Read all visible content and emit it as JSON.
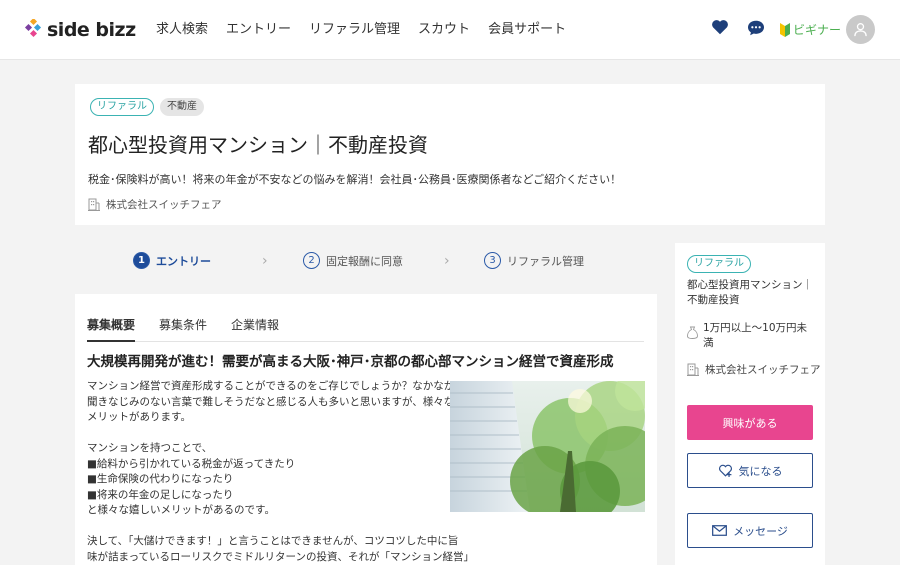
{
  "header": {
    "logo_text": "side bizz",
    "nav": [
      "求人検索",
      "エントリー",
      "リファラル管理",
      "スカウト",
      "会員サポート"
    ],
    "beginner_label": "ビギナー",
    "brand_color": "#1e4c9a"
  },
  "job": {
    "tags": [
      "リファラル",
      "不動産"
    ],
    "title": "都心型投資用マンション｜不動産投資",
    "description": "税金･保険料が高い！将来の年金が不安などの悩みを解消！会社員･公務員･医療関係者などご紹介ください！",
    "company": "株式会社スイッチフェア"
  },
  "steps": [
    {
      "num": "1",
      "label": "エントリー",
      "active": true
    },
    {
      "num": "2",
      "label": "固定報酬に同意",
      "active": false
    },
    {
      "num": "3",
      "label": "リファラル管理",
      "active": false
    }
  ],
  "content": {
    "tabs": [
      "募集概要",
      "募集条件",
      "企業情報"
    ],
    "section_title": "大規模再開発が進む！需要が高まる大阪･神戸･京都の都心部マンション経営で資産形成",
    "paragraph1": [
      "マンション経営で資産形成することができるのをご存じでしょうか？なかなか",
      "聞きなじみのない言葉で難しそうだなと感じる人も多いと思いますが、様々な",
      "メリットがあります。"
    ],
    "paragraph2": [
      "マンションを持つことで、",
      "■給料から引かれている税金が返ってきたり",
      "■生命保険の代わりになったり",
      "■将来の年金の足しになったり",
      "と様々な嬉しいメリットがあるのです。"
    ],
    "paragraph3": [
      "決して、「大儲けできます！」と言うことはできませんが、コツコツした中に旨",
      "味が詰まっているローリスクでミドルリターンの投資、それが「マンション経営」"
    ]
  },
  "sidebar": {
    "tag": "リファラル",
    "title": "都心型投資用マンション｜不動産投資",
    "salary": "1万円以上～10万円未満",
    "company": "株式会社スイッチフェア",
    "interest_button": "興味がある",
    "favorite_button": "気になる",
    "message_button": "メッセージ",
    "accent_color": "#e8458f"
  }
}
